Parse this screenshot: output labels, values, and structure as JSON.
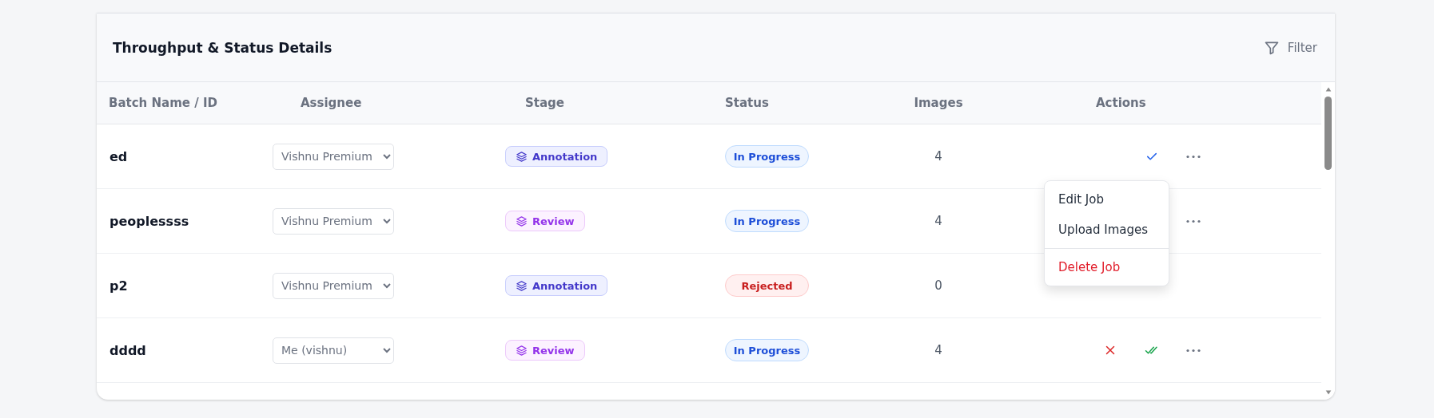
{
  "card": {
    "title": "Throughput & Status Details",
    "filter_button": "Filter"
  },
  "table": {
    "columns": [
      "Batch Name / ID",
      "Assignee",
      "Stage",
      "Status",
      "Images",
      "Actions"
    ],
    "rows": [
      {
        "name": "ed",
        "assignee": "Vishnu Premium",
        "stage": {
          "label": "Annotation",
          "kind": "annotation"
        },
        "status": {
          "label": "In Progress",
          "kind": "progress"
        },
        "images": "4",
        "actions": [
          {
            "kind": "approve"
          },
          {
            "kind": "more"
          }
        ]
      },
      {
        "name": "peoplessss",
        "assignee": "Vishnu Premium",
        "stage": {
          "label": "Review",
          "kind": "review"
        },
        "status": {
          "label": "In Progress",
          "kind": "progress"
        },
        "images": "4",
        "actions": [
          {
            "kind": "more"
          }
        ]
      },
      {
        "name": "p2",
        "assignee": "Vishnu Premium",
        "stage": {
          "label": "Annotation",
          "kind": "annotation"
        },
        "status": {
          "label": "Rejected",
          "kind": "rejected"
        },
        "images": "0",
        "actions": []
      },
      {
        "name": "dddd",
        "assignee": "Me (vishnu)",
        "stage": {
          "label": "Review",
          "kind": "review"
        },
        "status": {
          "label": "In Progress",
          "kind": "progress"
        },
        "images": "4",
        "actions": [
          {
            "kind": "reject"
          },
          {
            "kind": "approve_all"
          },
          {
            "kind": "more"
          }
        ]
      }
    ]
  },
  "context_menu": {
    "items": [
      {
        "label": "Edit Job",
        "kind": "normal"
      },
      {
        "label": "Upload Images",
        "kind": "normal"
      },
      {
        "label": "Delete Job",
        "kind": "danger"
      }
    ]
  }
}
